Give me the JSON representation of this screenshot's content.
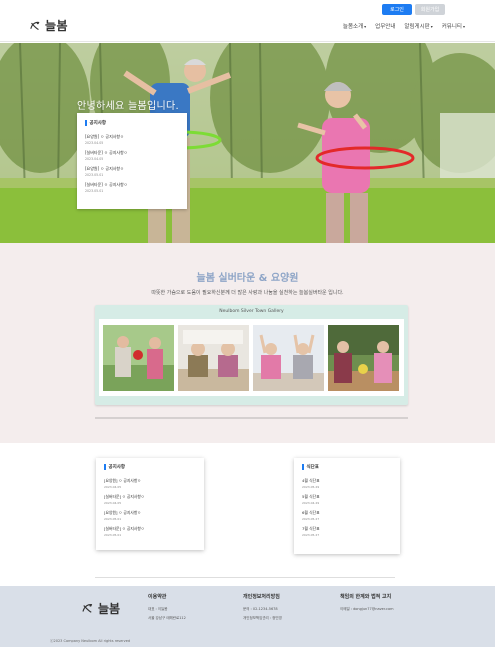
{
  "header": {
    "brand": "늘봄",
    "login_label": "로그인",
    "join_label": "회원가입",
    "nav": [
      "늘봄소개",
      "업무안내",
      "알림게시판",
      "커뮤니티"
    ]
  },
  "hero": {
    "title": "안녕하세요 늘봄입니다.",
    "notice_card": {
      "heading": "공지사항",
      "items": [
        {
          "title": "[요양원] ㅇ 공지사항ㅇ",
          "date": "2023.04.05"
        },
        {
          "title": "[실버타운] ㅇ 공지사항ㅇ",
          "date": "2023.04.05"
        },
        {
          "title": "[요양원] ㅇ 공지사항ㅇ",
          "date": "2023.05.01"
        },
        {
          "title": "[실버타운] ㅇ 공지사항ㅇ",
          "date": "2023.05.01"
        }
      ]
    }
  },
  "intro": {
    "title": "늘봄 실버타운 & 요양원",
    "subtitle": "따뜻한 가슴으로 도움이 필요하신분께 더 많은 사랑과 나눔을 실천하는 늘봄실버타운 입니다.",
    "gallery_title": "Neulbom Silver Town Gallery"
  },
  "boards": {
    "notice": {
      "heading": "공지사항",
      "items": [
        {
          "title": "[요양원] ㅇ 공지사항ㅇ",
          "date": "2023.04.05"
        },
        {
          "title": "[실버타운] ㅇ 공지사항ㅇ",
          "date": "2023.04.05"
        },
        {
          "title": "[요양원] ㅇ 공지사항ㅇ",
          "date": "2023.05.01"
        },
        {
          "title": "[실버타운] ㅇ 공지사항ㅇ",
          "date": "2023.05.01"
        }
      ]
    },
    "menu": {
      "heading": "식단표",
      "items": [
        {
          "title": "4월 식단표",
          "date": "2023.05.29"
        },
        {
          "title": "5월 식단표",
          "date": "2023.04.29"
        },
        {
          "title": "6월 식단표",
          "date": "2023.05.27"
        },
        {
          "title": "7월 식단표",
          "date": "2023.05.27"
        }
      ]
    }
  },
  "footer": {
    "brand": "늘봄",
    "col1": {
      "heading": "이용약관",
      "lines": [
        "대표 : 이늘봄",
        "서울 강남구 테헤란로112"
      ]
    },
    "col2": {
      "heading": "개인정보처리방침",
      "lines": [
        "문의 : 02-1234-5678",
        "개인정보책임관리 : 정민영"
      ]
    },
    "col3": {
      "heading": "책임의 한계와 법적 고지",
      "lines": [
        "이메일 : dongjun77@naver.com"
      ]
    },
    "copyright": "ⓒ2023 Company Neulbom All rights reserved"
  },
  "colors": {
    "accent": "#1d7cf2",
    "intro_bg": "#f4eded",
    "gallery_bg": "#d6ece6",
    "footer_bg": "#d9dfe8",
    "title_blue": "#8ea5c7"
  }
}
